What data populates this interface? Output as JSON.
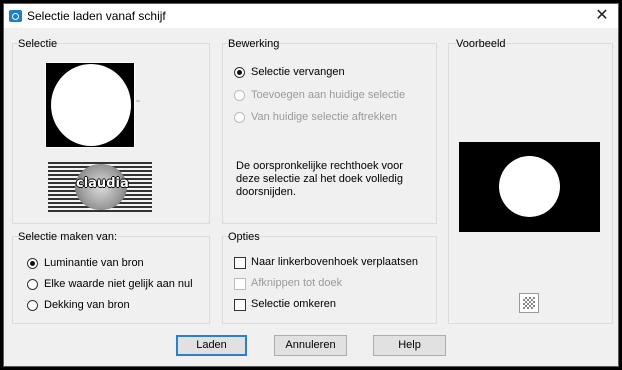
{
  "window": {
    "title": "Selectie laden vanaf schijf"
  },
  "groups": {
    "selectie": {
      "label": "Selectie",
      "source_name": "claudia"
    },
    "bewerking": {
      "label": "Bewerking",
      "options": [
        {
          "label": "Selectie vervangen",
          "checked": true,
          "enabled": true
        },
        {
          "label": "Toevoegen aan huidige selectie",
          "checked": false,
          "enabled": false
        },
        {
          "label": "Van huidige selectie aftrekken",
          "checked": false,
          "enabled": false
        }
      ],
      "note": "De oorspronkelijke rechthoek voor deze selectie zal het doek volledig doorsnijden."
    },
    "voorbeeld": {
      "label": "Voorbeeld"
    },
    "maken": {
      "label": "Selectie maken van:",
      "options": [
        {
          "label": "Luminantie van bron",
          "checked": true
        },
        {
          "label": "Elke waarde niet gelijk aan nul",
          "checked": false
        },
        {
          "label": "Dekking van bron",
          "checked": false
        }
      ]
    },
    "opties": {
      "label": "Opties",
      "options": [
        {
          "label": "Naar linkerbovenhoek verplaatsen",
          "checked": false,
          "enabled": true
        },
        {
          "label": "Afknippen tot doek",
          "checked": false,
          "enabled": false
        },
        {
          "label": "Selectie omkeren",
          "checked": false,
          "enabled": true
        }
      ]
    }
  },
  "buttons": {
    "load": "Laden",
    "cancel": "Annuleren",
    "help": "Help"
  }
}
